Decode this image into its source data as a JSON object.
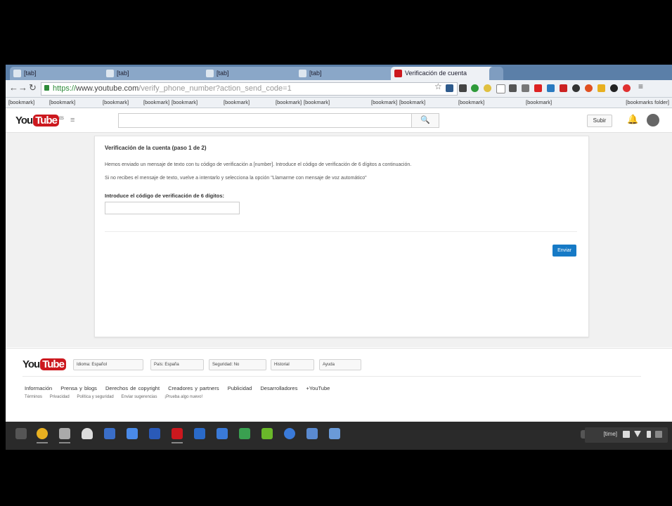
{
  "tabs": [
    {
      "label": "[tab]"
    },
    {
      "label": "[tab]"
    },
    {
      "label": "[tab]"
    },
    {
      "label": "[tab]"
    },
    {
      "label": "Verificación de cuenta",
      "active": true
    }
  ],
  "address": {
    "scheme": "https://",
    "host": "www.youtube.com",
    "path": "/verify_phone_number?action_send_code=1"
  },
  "bookmarks": [
    "[bookmark]",
    "[bookmark]",
    "[bookmark]",
    "[bookmark]",
    "[bookmark]",
    "[bookmark]",
    "[bookmark]",
    "[bookmark]",
    "[bookmark]",
    "[bookmark]",
    "[bookmark]",
    "[bookmark]"
  ],
  "bookmarks_folder": "[bookmarks folder]",
  "header": {
    "logo_you": "You",
    "logo_tube": "Tube",
    "logo_suffix": "ES",
    "search_icon": "search-icon",
    "upload_label": "Subir"
  },
  "verify": {
    "title": "Verificación de la cuenta (paso 1 de 2)",
    "line1": "Hemos enviado un mensaje de texto con tu código de verificación a [number]. Introduce el código de verificación de 6 dígitos a continuación.",
    "line2": "Si no recibes el mensaje de texto, vuelve a intentarlo y selecciona la opción \"Llamarme con mensaje de voz automático\"",
    "code_label": "Introduce el código de verificación de 6 dígitos:",
    "code_value": "",
    "submit_label": "Enviar"
  },
  "footer": {
    "logo_you": "You",
    "logo_tube": "Tube",
    "language": "Idioma: Español",
    "country": "País: España",
    "safety": "Seguridad: No",
    "history": "Historial",
    "help": "Ayuda",
    "links_primary": [
      "Información",
      "Prensa y blogs",
      "Derechos de copyright",
      "Creadores y partners",
      "Publicidad",
      "Desarrolladores",
      "+YouTube"
    ],
    "links_secondary": [
      "Términos",
      "Privacidad",
      "Política y seguridad",
      "Enviar sugerencias",
      "¡Prueba algo nuevo!"
    ]
  },
  "taskbar": {
    "time": "[time]"
  },
  "colors": {
    "tab_strip": "#5b7fa8",
    "youtube_red": "#cc181e",
    "submit_blue": "#167ac6",
    "taskbar": "#2a2a2a"
  }
}
